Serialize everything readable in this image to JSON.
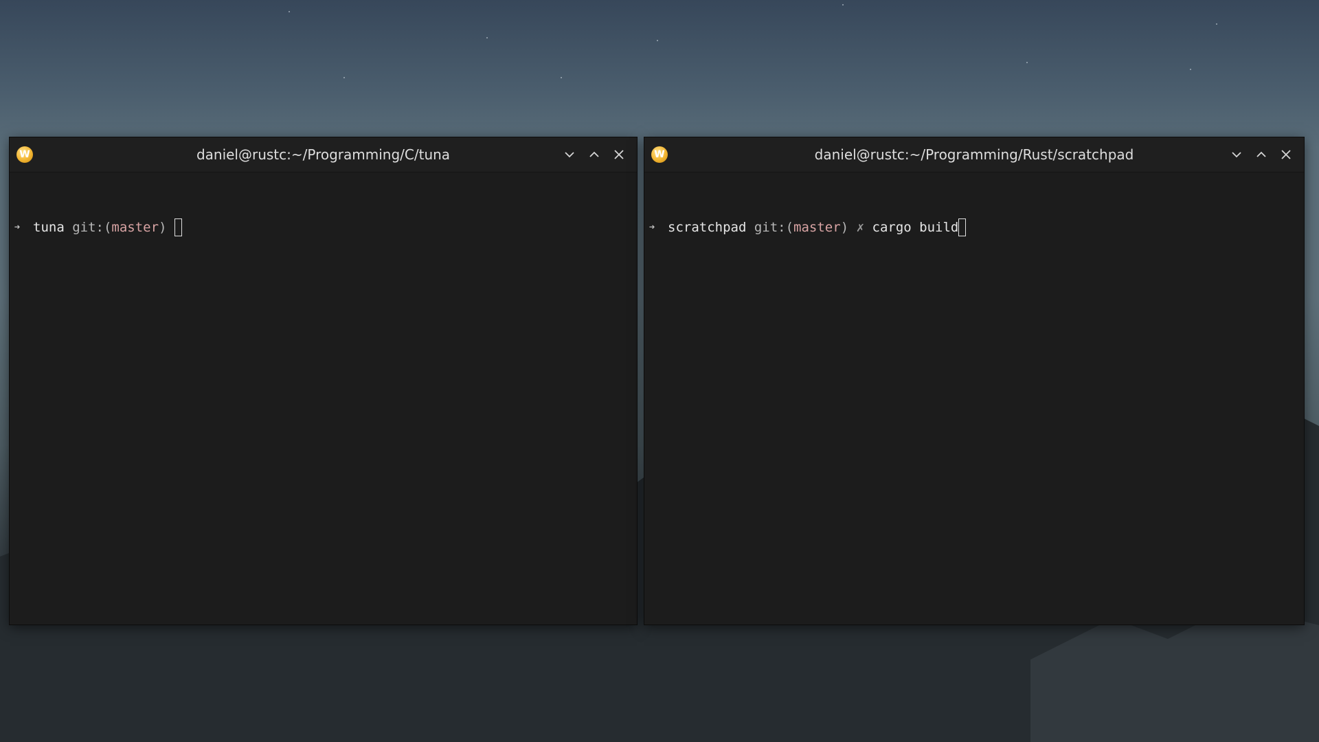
{
  "windows": {
    "left": {
      "title": "daniel@rustc:~/Programming/C/tuna",
      "app_icon_letter": "W",
      "prompt": {
        "arrow": "➜",
        "dir": "tuna",
        "git_prefix": "git:(",
        "branch": "master",
        "git_suffix": ")",
        "dirty_marker": "",
        "command": ""
      }
    },
    "right": {
      "title": "daniel@rustc:~/Programming/Rust/scratchpad",
      "app_icon_letter": "W",
      "prompt": {
        "arrow": "➜",
        "dir": "scratchpad",
        "git_prefix": "git:(",
        "branch": "master",
        "git_suffix": ")",
        "dirty_marker": "✗",
        "command": "cargo build"
      }
    }
  },
  "icons": {
    "app": "wezterm-icon",
    "minimize": "chevron-down-icon",
    "maximize": "chevron-up-icon",
    "close": "close-icon"
  },
  "colors": {
    "terminal_bg": "#1c1c1c",
    "titlebar_bg": "#1f1f1f",
    "branch": "#d9a4a4",
    "app_icon": "#f2b532"
  }
}
